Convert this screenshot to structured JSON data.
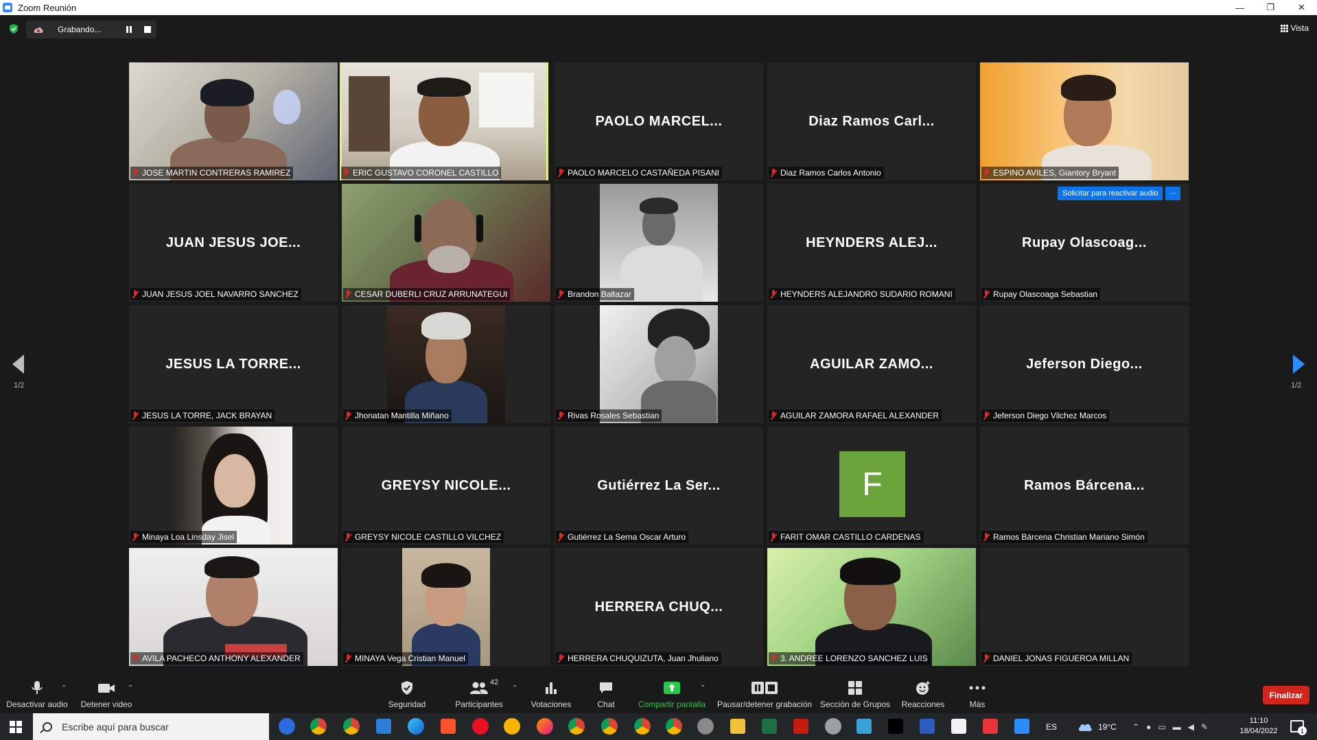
{
  "window": {
    "title": "Zoom Reunión",
    "minimize": "—",
    "restore": "❐",
    "close": "✕"
  },
  "topbar": {
    "recording_text": "Grabando...",
    "view_label": "Vista"
  },
  "pager": {
    "left": "1/2",
    "right": "1/2"
  },
  "participants": [
    {
      "label": "JOSE MARTIN CONTRERAS RAMIREZ",
      "video": true
    },
    {
      "label": "ERIC GUSTAVO CORONEL CASTILLO",
      "video": true,
      "active": true
    },
    {
      "label": "PAOLO MARCELO CASTAÑEDA PISANI",
      "display": "PAOLO MARCEL..."
    },
    {
      "label": "Diaz Ramos Carlos Antonio",
      "display": "Diaz Ramos Carl..."
    },
    {
      "label": "ESPINO AVILES, Giantory Bryant",
      "video": true
    },
    {
      "label": "JUAN JESUS JOEL NAVARRO SANCHEZ",
      "display": "JUAN JESUS JOE..."
    },
    {
      "label": "CESAR DUBERLI CRUZ ARRUNATEGUI",
      "video": true
    },
    {
      "label": "Brandon Baltazar",
      "video": true
    },
    {
      "label": "HEYNDERS ALEJANDRO SUDARIO ROMANI",
      "display": "HEYNDERS ALEJ..."
    },
    {
      "label": "Rupay Olascoaga Sebastian",
      "display": "Rupay Olascoag..."
    },
    {
      "label": "JESUS LA TORRE, JACK BRAYAN",
      "display": "JESUS LA TORRE..."
    },
    {
      "label": "Jhonatan Mantilla Miñano",
      "video": true
    },
    {
      "label": "Rivas Rosales Sebastian",
      "video": true
    },
    {
      "label": "AGUILAR ZAMORA RAFAEL ALEXANDER",
      "display": "AGUILAR ZAMO..."
    },
    {
      "label": "Jeferson Diego Vilchez Marcos",
      "display": "Jeferson Diego..."
    },
    {
      "label": "Minaya Loa Linsday Jisel",
      "video": true
    },
    {
      "label": "GREYSY NICOLE CASTILLO VILCHEZ",
      "display": "GREYSY NICOLE..."
    },
    {
      "label": "Gutiérrez La Serna Oscar Arturo",
      "display": "Gutiérrez La Ser..."
    },
    {
      "label": "FARIT OMAR CASTILLO CARDENAS",
      "avatar_letter": "F"
    },
    {
      "label": "Ramos Bárcena Christian Mariano Simón",
      "display": "Ramos Bárcena..."
    },
    {
      "label": "AVILA PACHECO ANTHONY ALEXANDER",
      "video": true
    },
    {
      "label": "MINAYA Vega Cristian Manuel",
      "video": true
    },
    {
      "label": "HERRERA CHUQUIZUTA, Juan Jhuliano",
      "display": "HERRERA CHUQ..."
    },
    {
      "label": "3. ANDREE LORENZO SANCHEZ LUIS",
      "video": true
    },
    {
      "label": "DANIEL JONAS FIGUEROA MILLAN"
    }
  ],
  "request_audio": {
    "label": "Solicitar para reactivar audio",
    "more": "···"
  },
  "toolbar": {
    "mute": "Desactivar audio",
    "video": "Detener video",
    "security": "Seguridad",
    "participants": "Participantes",
    "participants_count": "42",
    "polls": "Votaciones",
    "chat": "Chat",
    "share": "Compartir pantalla",
    "pause_rec": "Pausar/detener grabación",
    "breakout": "Sección de Grupos",
    "reactions": "Reacciones",
    "more": "Más",
    "end": "Finalizar",
    "caret": "⌃"
  },
  "taskbar": {
    "search_placeholder": "Escribe aquí para buscar",
    "lang": "ES",
    "temp": "19°C",
    "time": "11:10",
    "date": "18/04/2022",
    "notif_count": "1"
  },
  "colors": {
    "accent": "#2d8cff",
    "active_speaker": "#e2f27a",
    "muted": "#e02828",
    "end": "#d0251f",
    "share": "#27c84b"
  }
}
